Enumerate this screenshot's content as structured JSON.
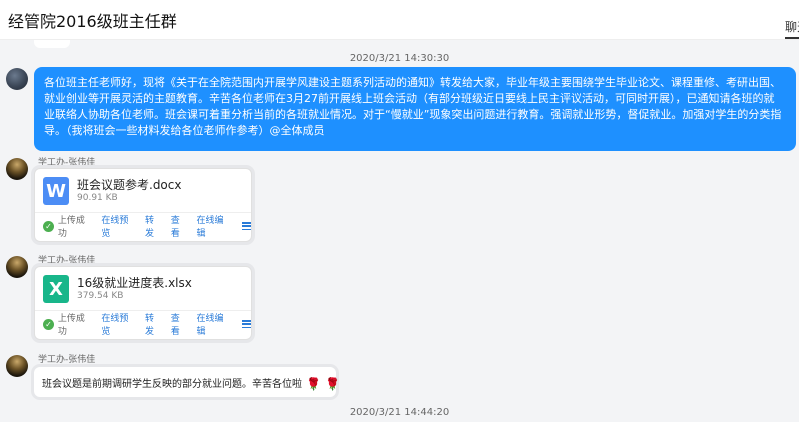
{
  "header": {
    "title": "经管院2016级班主任群",
    "tab_chat": "聊天"
  },
  "messages": {
    "timestamp_1": "2020/3/21 14:30:30",
    "announcement": {
      "text": "各位班主任老师好，现将《关于在全院范围内开展学风建设主题系列活动的通知》转发给大家，毕业年级主要围绕学生毕业论文、课程重修、考研出国、就业创业等开展灵活的主题教育。辛苦各位老师在3月27前开展线上班会活动（有部分班级近日要线上民主评议活动，可同时开展），已通知请各班的就业联络人协助各位老师。班会课可着重分析当前的各班就业情况。对于“慢就业”现象突出问题进行教育。强调就业形势，督促就业。加强对学生的分类指导。（我将班会一些材料发给各位老师作参考）@全体成员"
    },
    "file_1": {
      "sender": "学工办-张伟佳",
      "icon": "word-doc-icon",
      "icon_letter": "W",
      "name": "班会议题参考.docx",
      "size": "90.91 KB",
      "status": "上传成功",
      "actions": [
        "在线预览",
        "转发",
        "查看",
        "在线编辑"
      ]
    },
    "file_2": {
      "sender": "学工办-张伟佳",
      "icon": "excel-sheet-icon",
      "icon_letter": "X",
      "name": "16级就业进度表.xlsx",
      "size": "379.54 KB",
      "status": "上传成功",
      "actions": [
        "在线预览",
        "转发",
        "查看",
        "在线编辑"
      ]
    },
    "text_1": {
      "sender": "学工办-张伟佳",
      "text": "班会议题是前期调研学生反映的部分就业问题。辛苦各位啦",
      "emoji": "rose-icon"
    },
    "timestamp_2": "2020/3/21 14:44:20"
  },
  "colors": {
    "accent_blue": "#1e90ff",
    "link_blue": "#2a7bd8",
    "word_blue": "#4c8df5",
    "excel_green": "#18b68a",
    "success_green": "#4caf50"
  }
}
